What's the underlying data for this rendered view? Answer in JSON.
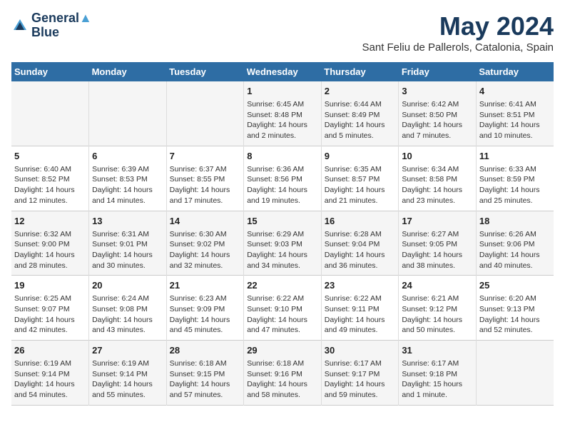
{
  "header": {
    "logo_line1": "General",
    "logo_line2": "Blue",
    "month_title": "May 2024",
    "location": "Sant Feliu de Pallerols, Catalonia, Spain"
  },
  "weekdays": [
    "Sunday",
    "Monday",
    "Tuesday",
    "Wednesday",
    "Thursday",
    "Friday",
    "Saturday"
  ],
  "weeks": [
    [
      {
        "day": "",
        "info": ""
      },
      {
        "day": "",
        "info": ""
      },
      {
        "day": "",
        "info": ""
      },
      {
        "day": "1",
        "info": "Sunrise: 6:45 AM\nSunset: 8:48 PM\nDaylight: 14 hours\nand 2 minutes."
      },
      {
        "day": "2",
        "info": "Sunrise: 6:44 AM\nSunset: 8:49 PM\nDaylight: 14 hours\nand 5 minutes."
      },
      {
        "day": "3",
        "info": "Sunrise: 6:42 AM\nSunset: 8:50 PM\nDaylight: 14 hours\nand 7 minutes."
      },
      {
        "day": "4",
        "info": "Sunrise: 6:41 AM\nSunset: 8:51 PM\nDaylight: 14 hours\nand 10 minutes."
      }
    ],
    [
      {
        "day": "5",
        "info": "Sunrise: 6:40 AM\nSunset: 8:52 PM\nDaylight: 14 hours\nand 12 minutes."
      },
      {
        "day": "6",
        "info": "Sunrise: 6:39 AM\nSunset: 8:53 PM\nDaylight: 14 hours\nand 14 minutes."
      },
      {
        "day": "7",
        "info": "Sunrise: 6:37 AM\nSunset: 8:55 PM\nDaylight: 14 hours\nand 17 minutes."
      },
      {
        "day": "8",
        "info": "Sunrise: 6:36 AM\nSunset: 8:56 PM\nDaylight: 14 hours\nand 19 minutes."
      },
      {
        "day": "9",
        "info": "Sunrise: 6:35 AM\nSunset: 8:57 PM\nDaylight: 14 hours\nand 21 minutes."
      },
      {
        "day": "10",
        "info": "Sunrise: 6:34 AM\nSunset: 8:58 PM\nDaylight: 14 hours\nand 23 minutes."
      },
      {
        "day": "11",
        "info": "Sunrise: 6:33 AM\nSunset: 8:59 PM\nDaylight: 14 hours\nand 25 minutes."
      }
    ],
    [
      {
        "day": "12",
        "info": "Sunrise: 6:32 AM\nSunset: 9:00 PM\nDaylight: 14 hours\nand 28 minutes."
      },
      {
        "day": "13",
        "info": "Sunrise: 6:31 AM\nSunset: 9:01 PM\nDaylight: 14 hours\nand 30 minutes."
      },
      {
        "day": "14",
        "info": "Sunrise: 6:30 AM\nSunset: 9:02 PM\nDaylight: 14 hours\nand 32 minutes."
      },
      {
        "day": "15",
        "info": "Sunrise: 6:29 AM\nSunset: 9:03 PM\nDaylight: 14 hours\nand 34 minutes."
      },
      {
        "day": "16",
        "info": "Sunrise: 6:28 AM\nSunset: 9:04 PM\nDaylight: 14 hours\nand 36 minutes."
      },
      {
        "day": "17",
        "info": "Sunrise: 6:27 AM\nSunset: 9:05 PM\nDaylight: 14 hours\nand 38 minutes."
      },
      {
        "day": "18",
        "info": "Sunrise: 6:26 AM\nSunset: 9:06 PM\nDaylight: 14 hours\nand 40 minutes."
      }
    ],
    [
      {
        "day": "19",
        "info": "Sunrise: 6:25 AM\nSunset: 9:07 PM\nDaylight: 14 hours\nand 42 minutes."
      },
      {
        "day": "20",
        "info": "Sunrise: 6:24 AM\nSunset: 9:08 PM\nDaylight: 14 hours\nand 43 minutes."
      },
      {
        "day": "21",
        "info": "Sunrise: 6:23 AM\nSunset: 9:09 PM\nDaylight: 14 hours\nand 45 minutes."
      },
      {
        "day": "22",
        "info": "Sunrise: 6:22 AM\nSunset: 9:10 PM\nDaylight: 14 hours\nand 47 minutes."
      },
      {
        "day": "23",
        "info": "Sunrise: 6:22 AM\nSunset: 9:11 PM\nDaylight: 14 hours\nand 49 minutes."
      },
      {
        "day": "24",
        "info": "Sunrise: 6:21 AM\nSunset: 9:12 PM\nDaylight: 14 hours\nand 50 minutes."
      },
      {
        "day": "25",
        "info": "Sunrise: 6:20 AM\nSunset: 9:13 PM\nDaylight: 14 hours\nand 52 minutes."
      }
    ],
    [
      {
        "day": "26",
        "info": "Sunrise: 6:19 AM\nSunset: 9:14 PM\nDaylight: 14 hours\nand 54 minutes."
      },
      {
        "day": "27",
        "info": "Sunrise: 6:19 AM\nSunset: 9:14 PM\nDaylight: 14 hours\nand 55 minutes."
      },
      {
        "day": "28",
        "info": "Sunrise: 6:18 AM\nSunset: 9:15 PM\nDaylight: 14 hours\nand 57 minutes."
      },
      {
        "day": "29",
        "info": "Sunrise: 6:18 AM\nSunset: 9:16 PM\nDaylight: 14 hours\nand 58 minutes."
      },
      {
        "day": "30",
        "info": "Sunrise: 6:17 AM\nSunset: 9:17 PM\nDaylight: 14 hours\nand 59 minutes."
      },
      {
        "day": "31",
        "info": "Sunrise: 6:17 AM\nSunset: 9:18 PM\nDaylight: 15 hours\nand 1 minute."
      },
      {
        "day": "",
        "info": ""
      }
    ]
  ]
}
